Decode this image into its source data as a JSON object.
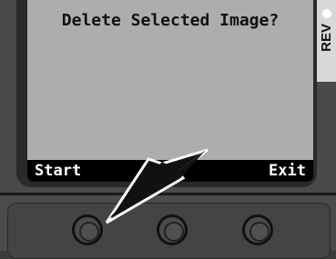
{
  "screen": {
    "prompt": "Delete Selected Image?",
    "softkeys": {
      "left": "Start",
      "right": "Exit"
    }
  },
  "device": {
    "side_label": "REV",
    "buttons": [
      "left-softkey-button",
      "center-button",
      "right-softkey-button"
    ]
  },
  "annotation": {
    "arrow_target": "left-softkey-button",
    "arrow_color": "#ffffff"
  }
}
